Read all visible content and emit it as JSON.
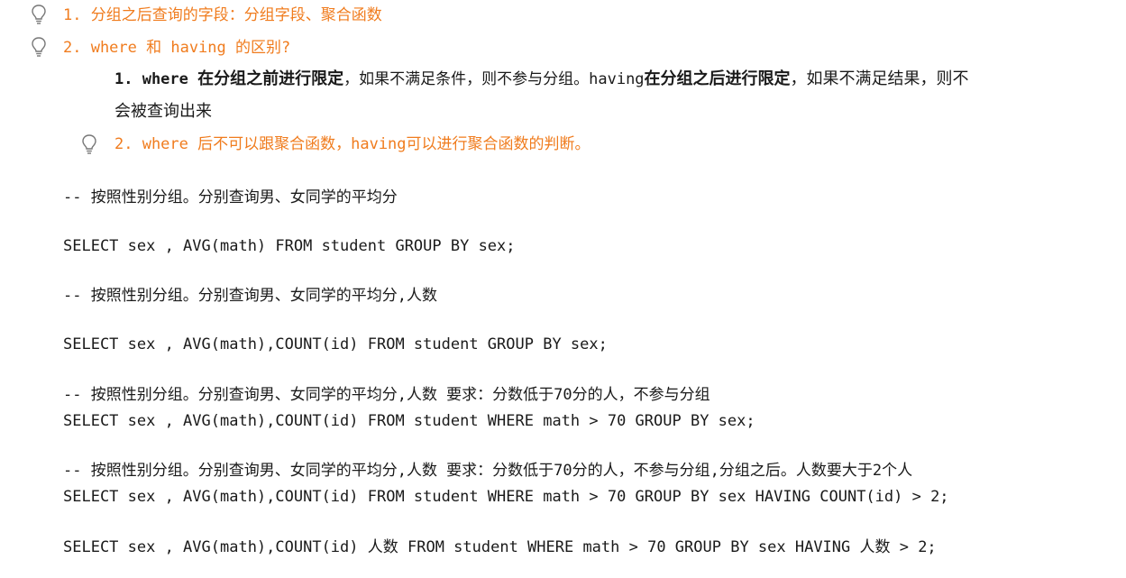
{
  "tips": {
    "tip1": "1. 分组之后查询的字段：分组字段、聚合函数",
    "tip2": "2. where 和 having 的区别?"
  },
  "diff": {
    "item1_prefix": "1. where ",
    "item1_b1": "在分组之前进行限定",
    "item1_t1": "，如果不满足条件，则不参与分组。having",
    "item1_b2": "在分组之后进行限定",
    "item1_t2": "，如果不满足结果，则不",
    "item1_cont": "会被查询出来",
    "item2": "2. where 后不可以跟聚合函数，having可以进行聚合函数的判断。"
  },
  "code": {
    "comment1": "-- 按照性别分组。分别查询男、女同学的平均分",
    "sql1": "SELECT sex , AVG(math) FROM student GROUP BY sex;",
    "comment2": "-- 按照性别分组。分别查询男、女同学的平均分,人数",
    "sql2": "SELECT sex , AVG(math),COUNT(id) FROM student GROUP BY sex;",
    "comment3": "--  按照性别分组。分别查询男、女同学的平均分,人数 要求：分数低于70分的人，不参与分组",
    "sql3": "SELECT sex , AVG(math),COUNT(id) FROM student WHERE math > 70 GROUP BY sex;",
    "comment4": "--  按照性别分组。分别查询男、女同学的平均分,人数 要求：分数低于70分的人，不参与分组,分组之后。人数要大于2个人",
    "sql4": "SELECT sex , AVG(math),COUNT(id) FROM student WHERE math > 70 GROUP BY sex HAVING COUNT(id) > 2;",
    "sql5": "SELECT sex , AVG(math),COUNT(id) 人数 FROM student WHERE math > 70 GROUP BY sex HAVING 人数 > 2;"
  }
}
